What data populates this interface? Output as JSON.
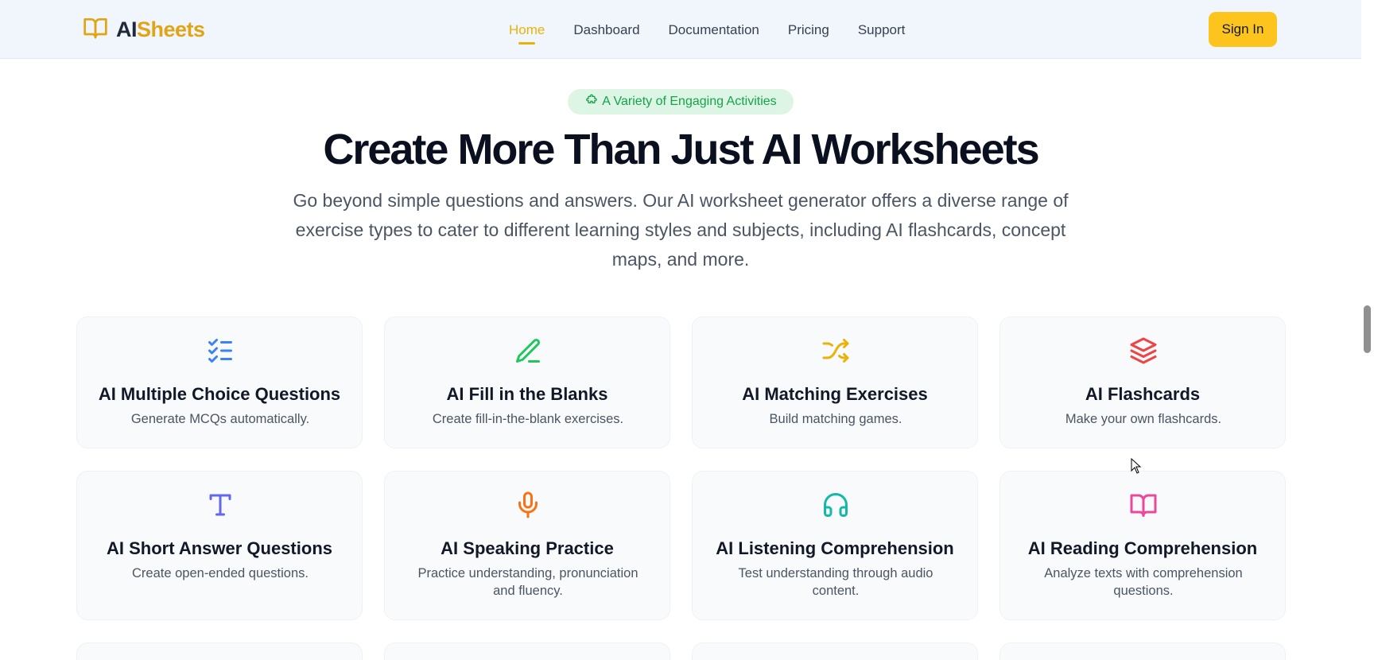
{
  "header": {
    "logo_ai": "AI",
    "logo_sheets": "Sheets",
    "nav": [
      "Home",
      "Dashboard",
      "Documentation",
      "Pricing",
      "Support"
    ],
    "active_nav": "Home",
    "sign_in": "Sign In"
  },
  "hero": {
    "badge": "A Variety of Engaging Activities",
    "title": "Create More Than Just AI Worksheets",
    "subtitle": "Go beyond simple questions and answers. Our AI worksheet generator offers a diverse range of exercise types to cater to different learning styles and subjects, including AI flashcards, concept maps, and more."
  },
  "cards": [
    {
      "title": "AI Multiple Choice Questions",
      "desc": "Generate MCQs automatically.",
      "icon": "list-checks-icon",
      "color": "#3b82f6"
    },
    {
      "title": "AI Fill in the Blanks",
      "desc": "Create fill-in-the-blank exercises.",
      "icon": "pen-line-icon",
      "color": "#22c55e"
    },
    {
      "title": "AI Matching Exercises",
      "desc": "Build matching games.",
      "icon": "shuffle-icon",
      "color": "#eab308"
    },
    {
      "title": "AI Flashcards",
      "desc": "Make your own flashcards.",
      "icon": "layers-icon",
      "color": "#ef4444"
    },
    {
      "title": "AI Short Answer Questions",
      "desc": "Create open-ended questions.",
      "icon": "type-icon",
      "color": "#6366f1"
    },
    {
      "title": "AI Speaking Practice",
      "desc": "Practice understanding, pronunciation and fluency.",
      "icon": "mic-icon",
      "color": "#f97316"
    },
    {
      "title": "AI Listening Comprehension",
      "desc": "Test understanding through audio content.",
      "icon": "headphones-icon",
      "color": "#14b8a6"
    },
    {
      "title": "AI Reading Comprehension",
      "desc": "Analyze texts with comprehension questions.",
      "icon": "book-open-icon",
      "color": "#ec4899"
    }
  ],
  "colors": {
    "brand_yellow": "#fcc41d",
    "badge_green": "#16a34a"
  }
}
